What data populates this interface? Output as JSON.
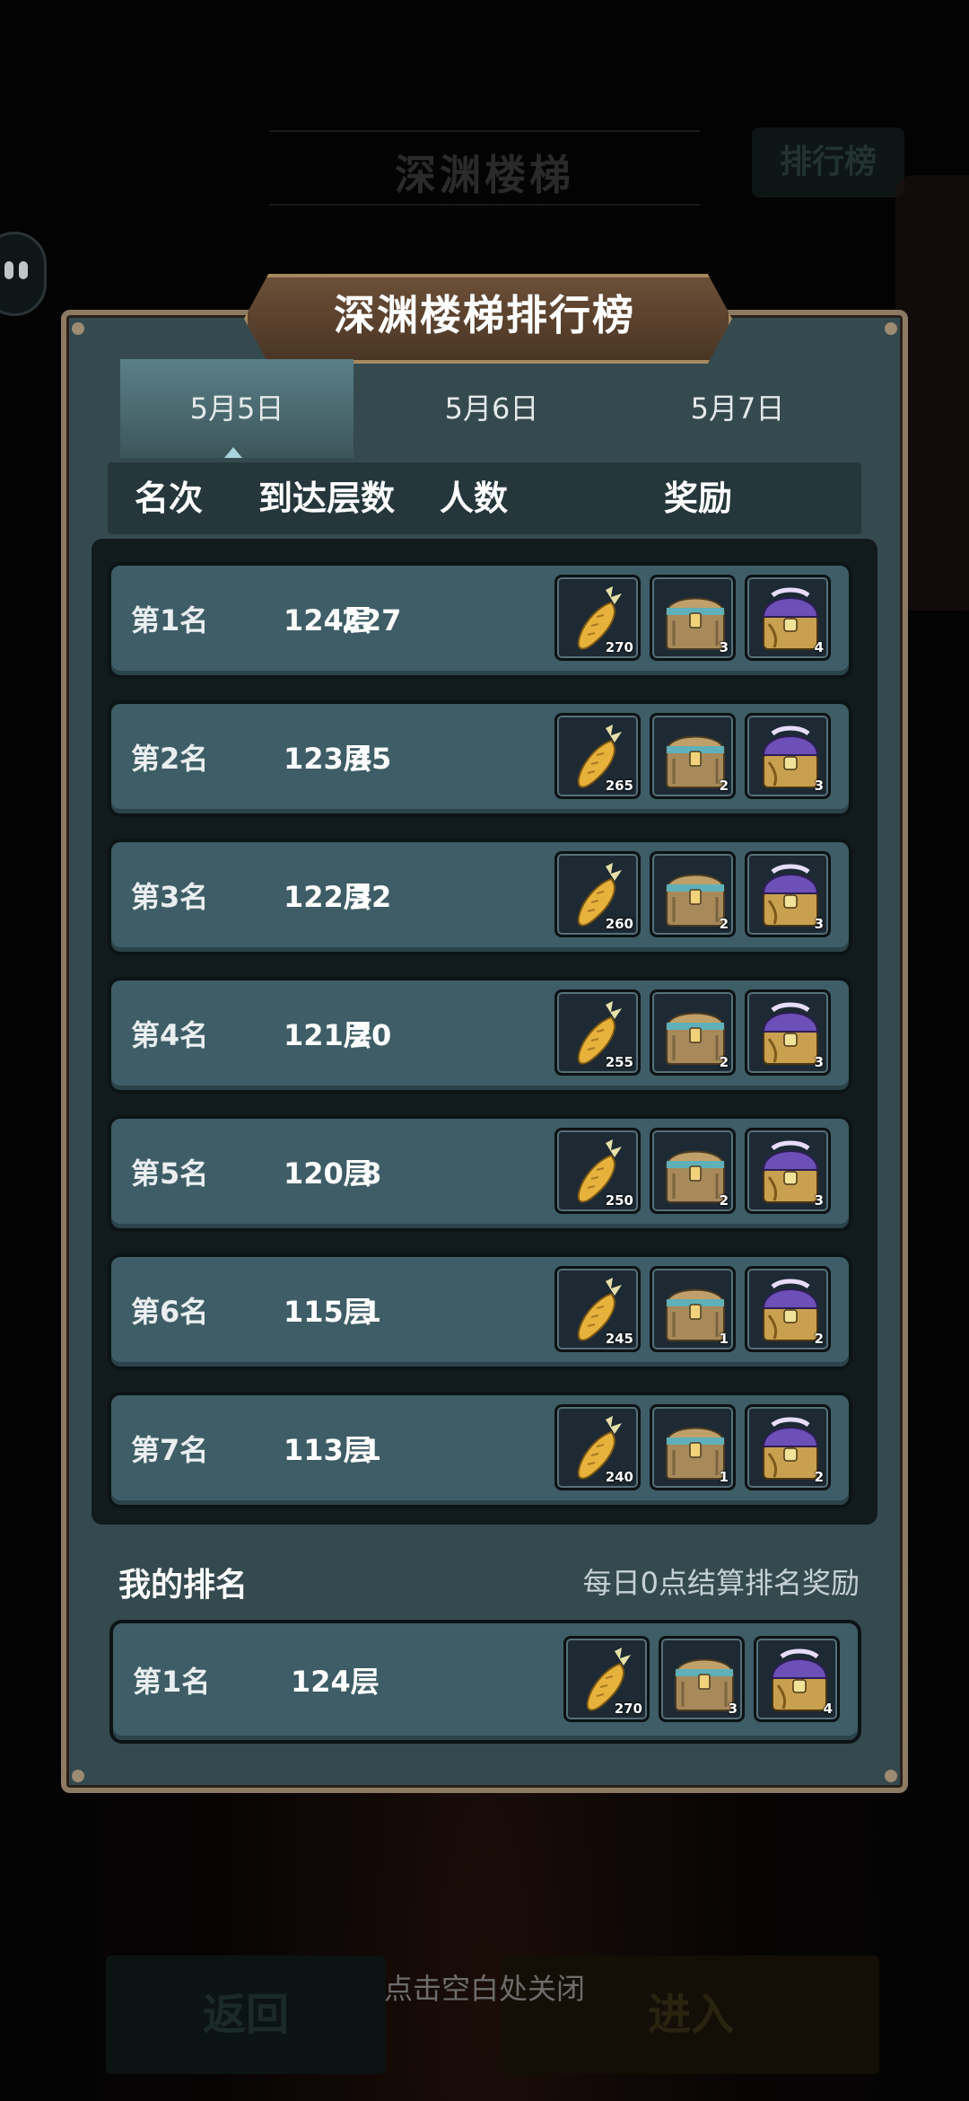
{
  "background": {
    "screen_title": "深渊楼梯",
    "rank_button": "排行榜",
    "back_button": "返回",
    "enter_button": "进入",
    "close_hint": "点击空白处关闭"
  },
  "panel": {
    "title": "深渊楼梯排行榜",
    "tabs": [
      {
        "label": "5月5日",
        "active": true
      },
      {
        "label": "5月6日",
        "active": false
      },
      {
        "label": "5月7日",
        "active": false
      }
    ],
    "columns": {
      "rank": "名次",
      "floor": "到达层数",
      "count": "人数",
      "reward": "奖励"
    },
    "rows": [
      {
        "rank": "第1名",
        "floor": "124层",
        "count": "227",
        "rewards": [
          "270",
          "3",
          "4"
        ]
      },
      {
        "rank": "第2名",
        "floor": "123层",
        "count": "45",
        "rewards": [
          "265",
          "2",
          "3"
        ]
      },
      {
        "rank": "第3名",
        "floor": "122层",
        "count": "32",
        "rewards": [
          "260",
          "2",
          "3"
        ]
      },
      {
        "rank": "第4名",
        "floor": "121层",
        "count": "20",
        "rewards": [
          "255",
          "2",
          "3"
        ]
      },
      {
        "rank": "第5名",
        "floor": "120层",
        "count": "8",
        "rewards": [
          "250",
          "2",
          "3"
        ]
      },
      {
        "rank": "第6名",
        "floor": "115层",
        "count": "1",
        "rewards": [
          "245",
          "1",
          "2"
        ]
      },
      {
        "rank": "第7名",
        "floor": "113层",
        "count": "1",
        "rewards": [
          "240",
          "1",
          "2"
        ]
      }
    ],
    "my_rank": {
      "title": "我的排名",
      "note": "每日0点结算排名奖励",
      "rank": "第1名",
      "floor": "124层",
      "rewards": [
        "270",
        "3",
        "4"
      ]
    },
    "reward_icons": [
      "carrot-icon",
      "treasure-chest-icon",
      "purple-chest-icon"
    ]
  }
}
